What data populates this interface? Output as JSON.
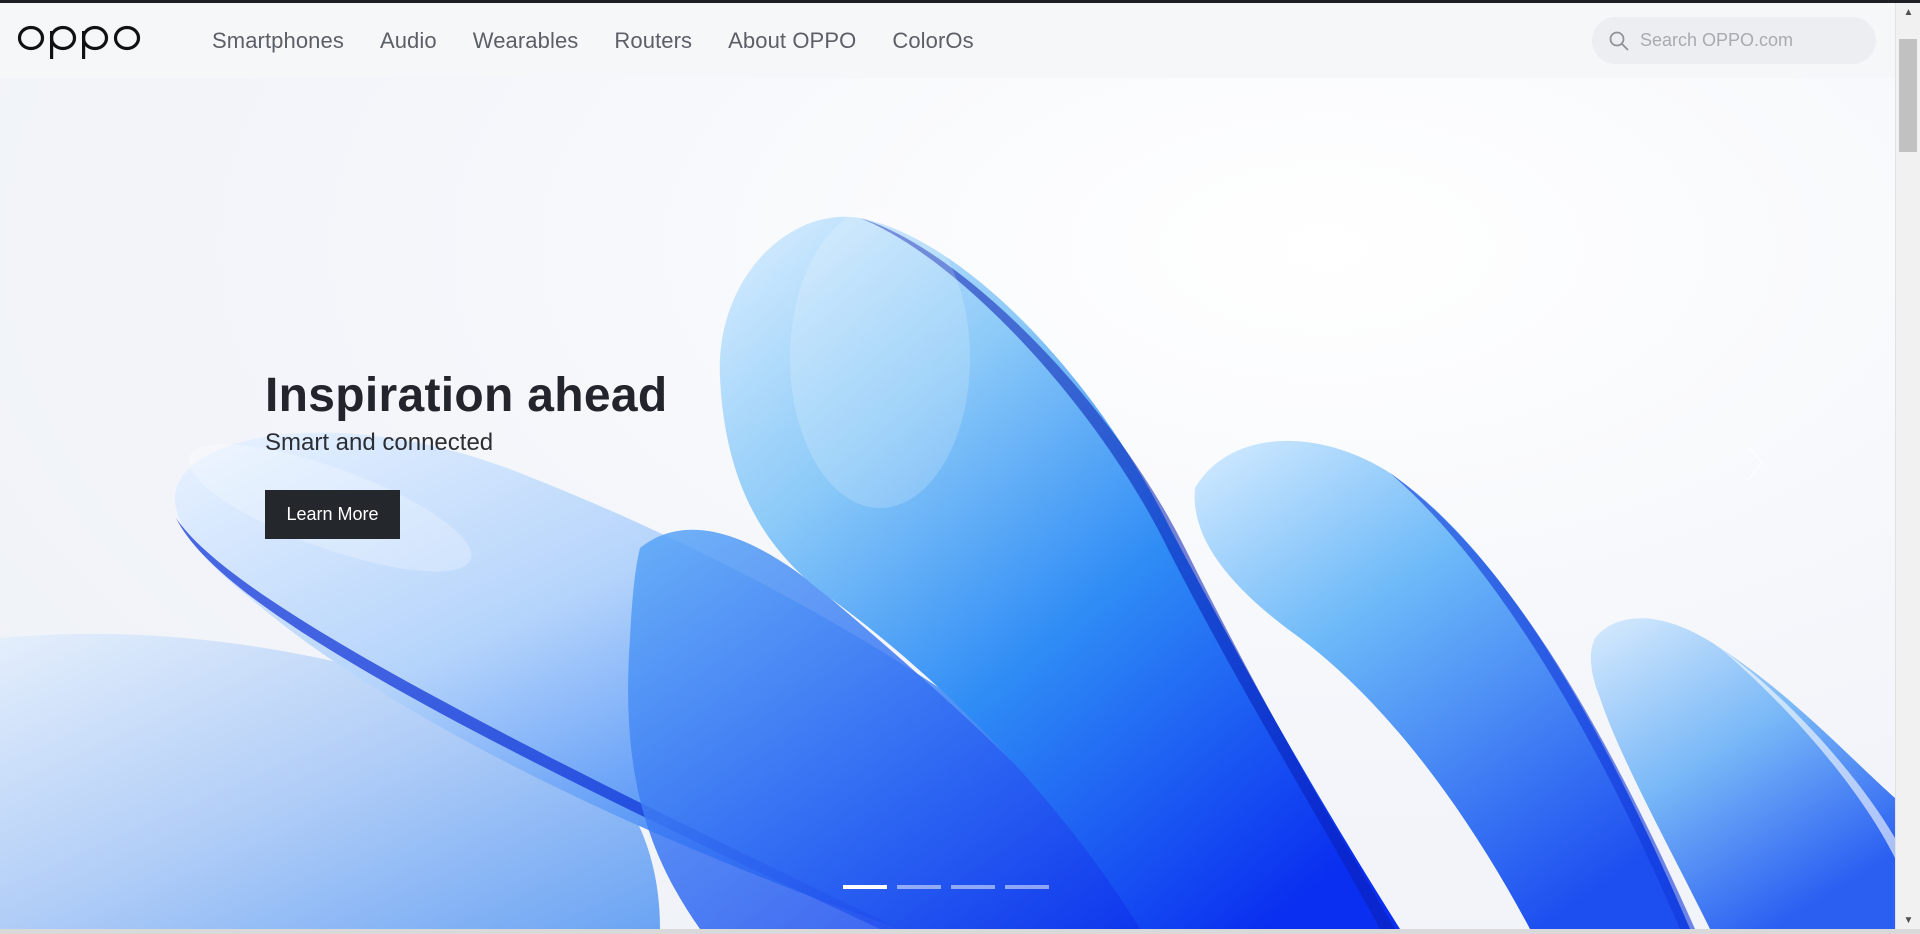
{
  "brand": {
    "logo_text": "oppo"
  },
  "nav": {
    "items": [
      "Smartphones",
      "Audio",
      "Wearables",
      "Routers",
      "About OPPO",
      "ColorOs"
    ]
  },
  "search": {
    "placeholder": "Search OPPO.com",
    "value": ""
  },
  "hero": {
    "title": "Inspiration ahead",
    "subtitle": "Smart and connected",
    "cta_label": "Learn More",
    "slides_total": 4,
    "active_slide": 1
  },
  "colors": {
    "header_bg": "#f6f7f9",
    "nav_text": "#5b5f66",
    "cta_bg": "#24272b",
    "accent_blue": "#1f6bff"
  },
  "icons": {
    "search": "search-icon",
    "next": "chevron-right-icon",
    "scroll_up": "scroll-up-arrow-icon",
    "scroll_down": "scroll-down-arrow-icon"
  }
}
